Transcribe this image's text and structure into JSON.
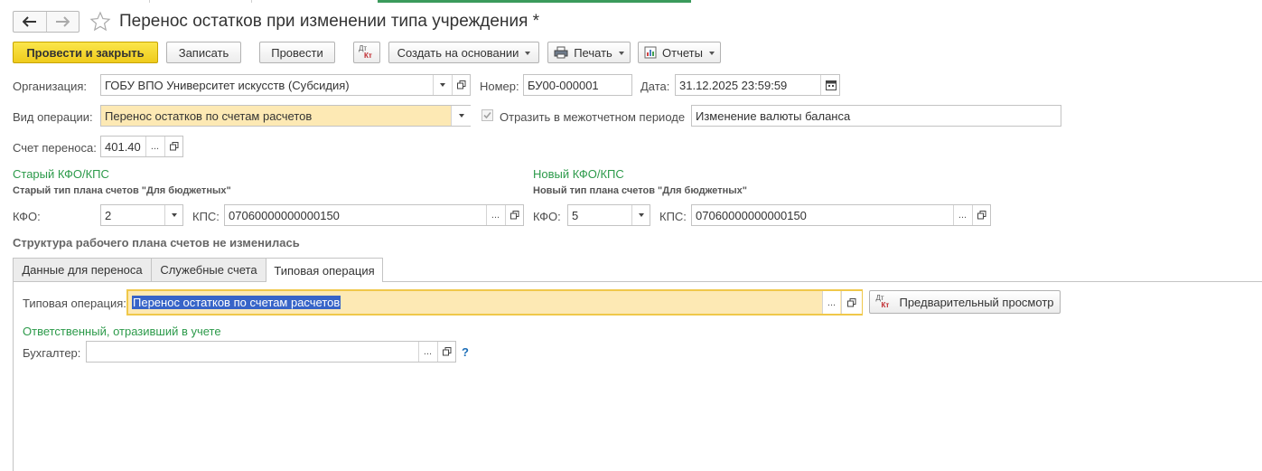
{
  "window": {
    "title": "Перенос остатков при изменении типа учреждения *"
  },
  "toolbar": {
    "post_and_close": "Провести и закрыть",
    "save": "Записать",
    "post": "Провести",
    "dt_kt_icon_top": "Дт",
    "dt_kt_icon_bottom": "Кт",
    "create_based_on": "Создать на основании",
    "print": "Печать",
    "reports": "Отчеты"
  },
  "form": {
    "organization_label": "Организация:",
    "organization_value": "ГОБУ ВПО Университет искусств (Субсидия)",
    "number_label": "Номер:",
    "number_value": "БУ00-000001",
    "date_label": "Дата:",
    "date_value": "31.12.2025 23:59:59",
    "operation_type_label": "Вид операции:",
    "operation_type_value": "Перенос остатков по счетам расчетов",
    "interperiod_label": "Отразить в межотчетном периоде",
    "interperiod_checked": true,
    "balance_currency_value": "Изменение валюты баланса",
    "transfer_account_label": "Счет переноса:",
    "transfer_account_value": "401.40"
  },
  "old": {
    "header": "Старый КФО/КПС",
    "note": "Старый тип плана счетов \"Для бюджетных\"",
    "kfo_label": "КФО:",
    "kfo_value": "2",
    "kps_label": "КПС:",
    "kps_value": "07060000000000150"
  },
  "new": {
    "header": "Новый КФО/КПС",
    "note": "Новый тип плана счетов \"Для бюджетных\"",
    "kfo_label": "КФО:",
    "kfo_value": "5",
    "kps_label": "КПС:",
    "kps_value": "07060000000000150"
  },
  "structure_note": "Структура рабочего плана счетов не изменилась",
  "tabs": [
    {
      "label": "Данные для переноса"
    },
    {
      "label": "Служебные счета"
    },
    {
      "label": "Типовая операция"
    }
  ],
  "typical_tab": {
    "operation_label": "Типовая операция:",
    "operation_value": "Перенос остатков по счетам расчетов",
    "preview_button": "Предварительный просмотр",
    "responsible_header": "Ответственный, отразивший в учете",
    "accountant_label": "Бухгалтер:",
    "accountant_value": "",
    "help": "?"
  },
  "colors": {
    "primary_button": "#f2d024",
    "highlight_field": "#fde9b4",
    "section_green": "#2c9a4a",
    "selection": "#3764c8"
  }
}
